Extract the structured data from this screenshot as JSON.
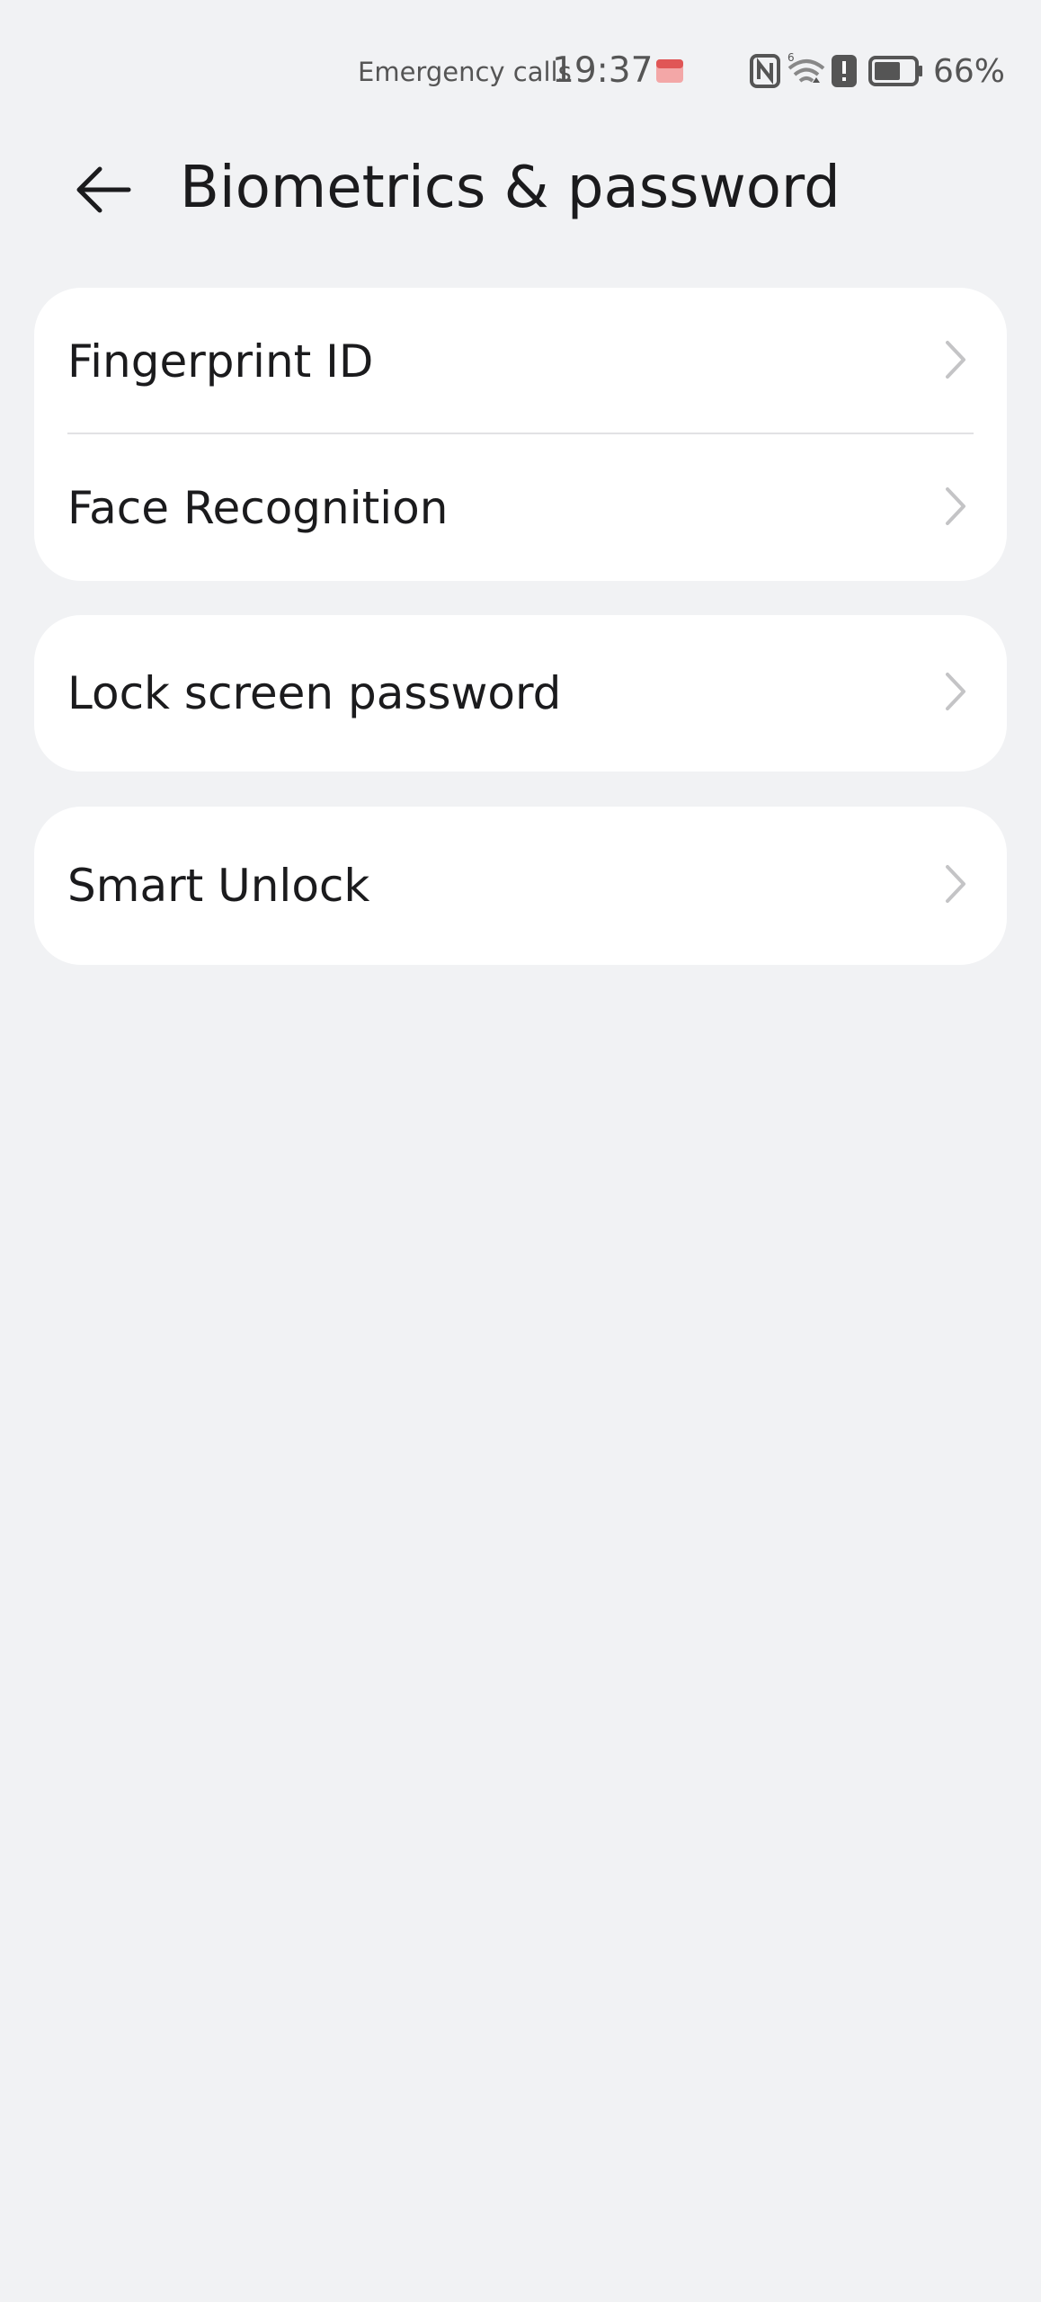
{
  "status_bar": {
    "carrier_text": "Emergency calls",
    "time": "19:37",
    "battery_percent": "66%",
    "icons": [
      "app-notification-icon",
      "nfc-icon",
      "wifi-icon",
      "alert-icon",
      "battery-icon"
    ],
    "battery_level": 0.66
  },
  "header": {
    "title": "Biometrics & password",
    "back_icon": "back-arrow-icon"
  },
  "sections": [
    {
      "items": [
        {
          "label": "Fingerprint ID"
        },
        {
          "label": "Face Recognition"
        }
      ]
    },
    {
      "items": [
        {
          "label": "Lock screen password"
        }
      ]
    },
    {
      "items": [
        {
          "label": "Smart Unlock"
        }
      ]
    }
  ],
  "colors": {
    "background": "#f1f2f4",
    "card": "#ffffff",
    "text": "#1b1b1d",
    "chevron": "#c4c4c6"
  }
}
